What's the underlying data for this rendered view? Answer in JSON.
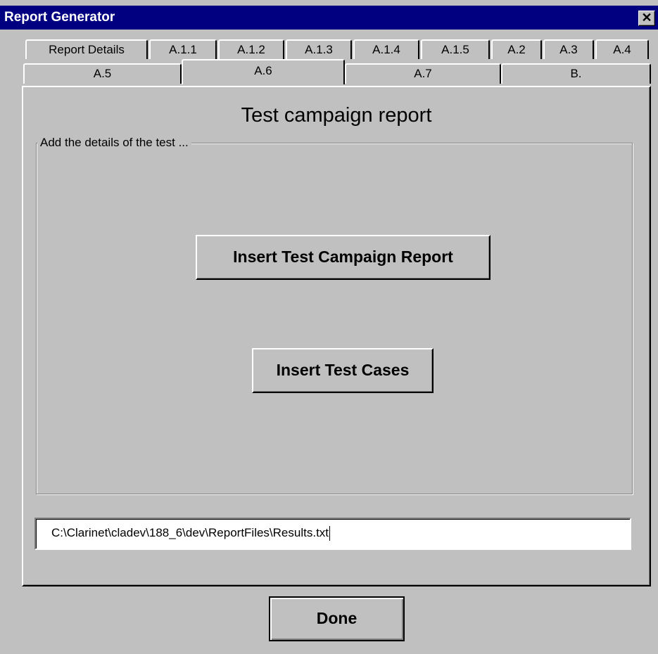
{
  "window": {
    "title": "Report Generator",
    "close_glyph": "✕"
  },
  "tabs_row1": [
    "Report Details",
    "A.1.1",
    "A.1.2",
    "A.1.3",
    "A.1.4",
    "A.1.5",
    "A.2",
    "A.3",
    "A.4"
  ],
  "tabs_row2": [
    "A.5",
    "A.6",
    "A.7",
    "B."
  ],
  "active_tab": "A.6",
  "panel": {
    "title": "Test campaign report",
    "group_label": "Add the details of the test ...",
    "insert_campaign_label": "Insert Test Campaign Report",
    "insert_cases_label": "Insert Test Cases",
    "path_value": "C:\\Clarinet\\cladev\\188_6\\dev\\ReportFiles\\Results.txt"
  },
  "footer": {
    "done_label": "Done"
  },
  "colors": {
    "titlebar": "#000080",
    "face": "#c0c0c0"
  },
  "icons": {
    "close": "close-icon"
  }
}
